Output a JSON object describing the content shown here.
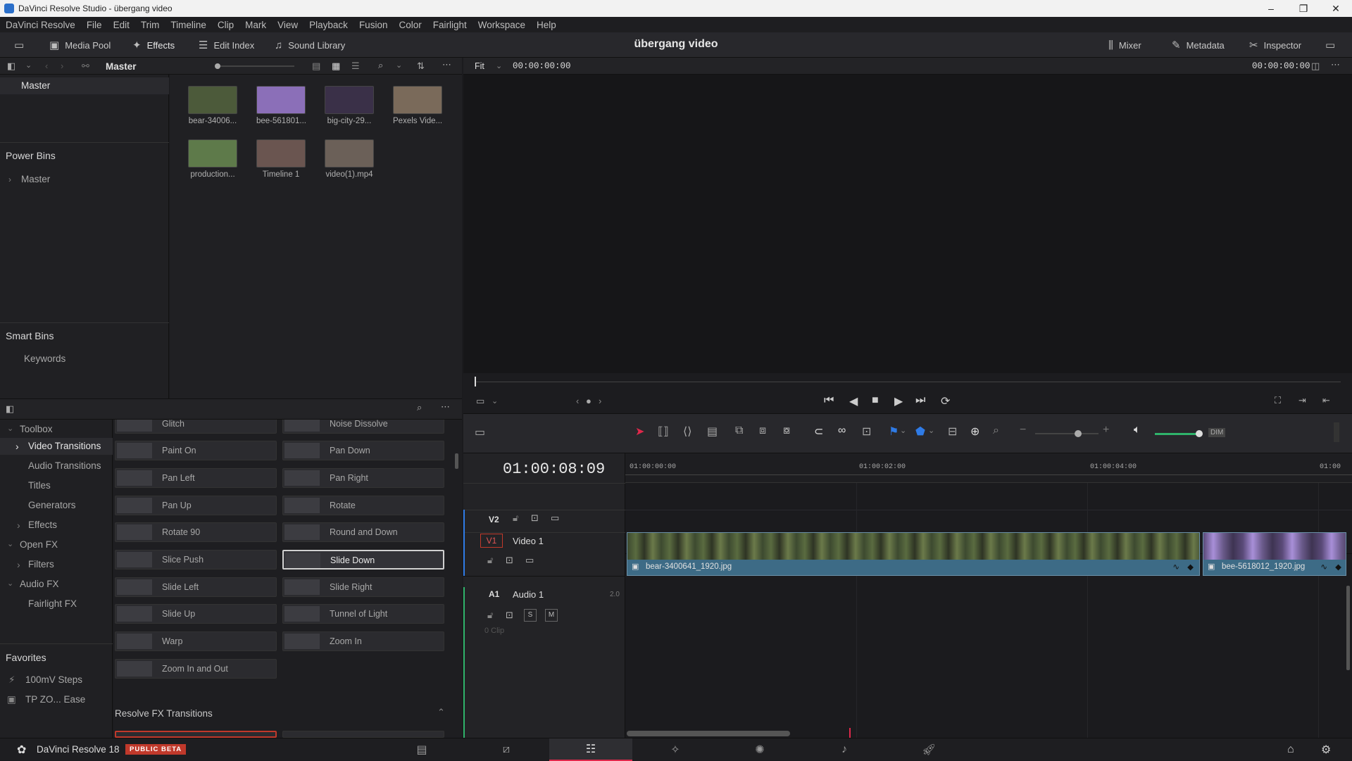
{
  "window": {
    "title": "DaVinci Resolve Studio - übergang video",
    "minimize": "–",
    "restore": "❐",
    "close": "✕"
  },
  "menu": [
    "DaVinci Resolve",
    "File",
    "Edit",
    "Trim",
    "Timeline",
    "Clip",
    "Mark",
    "View",
    "Playback",
    "Fusion",
    "Color",
    "Fairlight",
    "Workspace",
    "Help"
  ],
  "toolbar": {
    "media_pool": "Media Pool",
    "effects": "Effects",
    "edit_index": "Edit Index",
    "sound_library": "Sound Library",
    "project_title": "übergang video",
    "mixer": "Mixer",
    "metadata": "Metadata",
    "inspector": "Inspector"
  },
  "media_pool": {
    "bin_name": "Master",
    "bins": {
      "master": "Master",
      "power_bins_title": "Power Bins",
      "power_bins_item": "Master",
      "smart_bins_title": "Smart Bins",
      "smart_bins_item": "Keywords"
    },
    "clips": [
      {
        "label": "bear-34006...",
        "color": "#4c5a3a"
      },
      {
        "label": "bee-561801...",
        "color": "#8b6fb8"
      },
      {
        "label": "big-city-29...",
        "color": "#3a3048"
      },
      {
        "label": "Pexels Vide...",
        "color": "#7a6a5a"
      },
      {
        "label": "production...",
        "color": "#5e7a4a"
      },
      {
        "label": "Timeline 1",
        "color": "#6a5550"
      },
      {
        "label": "video(1).mp4",
        "color": "#6b6058"
      }
    ]
  },
  "viewer": {
    "fit": "Fit",
    "timecode_left": "00:00:00:00",
    "timecode_right": "00:00:00:00"
  },
  "effects": {
    "tree": [
      {
        "label": "Toolbox",
        "arrow": "⌄"
      },
      {
        "label": "Video Transitions",
        "arrow": "›"
      },
      {
        "label": "Audio Transitions",
        "arrow": ""
      },
      {
        "label": "Titles",
        "arrow": ""
      },
      {
        "label": "Generators",
        "arrow": ""
      },
      {
        "label": "Effects",
        "arrow": "›"
      },
      {
        "label": "Open FX",
        "arrow": "⌄"
      },
      {
        "label": "Filters",
        "arrow": "›"
      },
      {
        "label": "Audio FX",
        "arrow": "⌄"
      },
      {
        "label": "Fairlight FX",
        "arrow": ""
      }
    ],
    "favorites_title": "Favorites",
    "favorites": [
      "100mV Steps",
      "TP ZO... Ease"
    ],
    "transitions": [
      "Glitch",
      "Noise Dissolve",
      "Paint On",
      "Pan Down",
      "Pan Left",
      "Pan Right",
      "Pan Up",
      "Rotate",
      "Rotate 90",
      "Round and Down",
      "Slice Push",
      "Slide Down",
      "Slide Left",
      "Slide Right",
      "Slide Up",
      "Tunnel of Light",
      "Warp",
      "Zoom In",
      "Zoom In and Out"
    ],
    "section_title": "Resolve FX Transitions"
  },
  "timeline": {
    "timecode": "01:00:08:09",
    "ruler": [
      "01:00:00:00",
      "01:00:02:00",
      "01:00:04:00",
      "01:00"
    ],
    "tracks": {
      "v2": "V2",
      "v1": "V1",
      "v1_name": "Video 1",
      "a1": "A1",
      "a1_name": "Audio 1",
      "a1_channels": "2.0",
      "a1_clips": "0 Clip",
      "solo": "S",
      "mute": "M"
    },
    "clips": [
      {
        "name": "bear-3400641_1920.jpg"
      },
      {
        "name": "bee-5618012_1920.jpg"
      }
    ],
    "dim": "DIM"
  },
  "pagebar": {
    "app_name": "DaVinci Resolve 18",
    "beta": "PUBLIC BETA"
  },
  "colors": {
    "accent": "#e0284b",
    "clip_bar": "#3d6b86",
    "flag_blue": "#2f7be6"
  }
}
